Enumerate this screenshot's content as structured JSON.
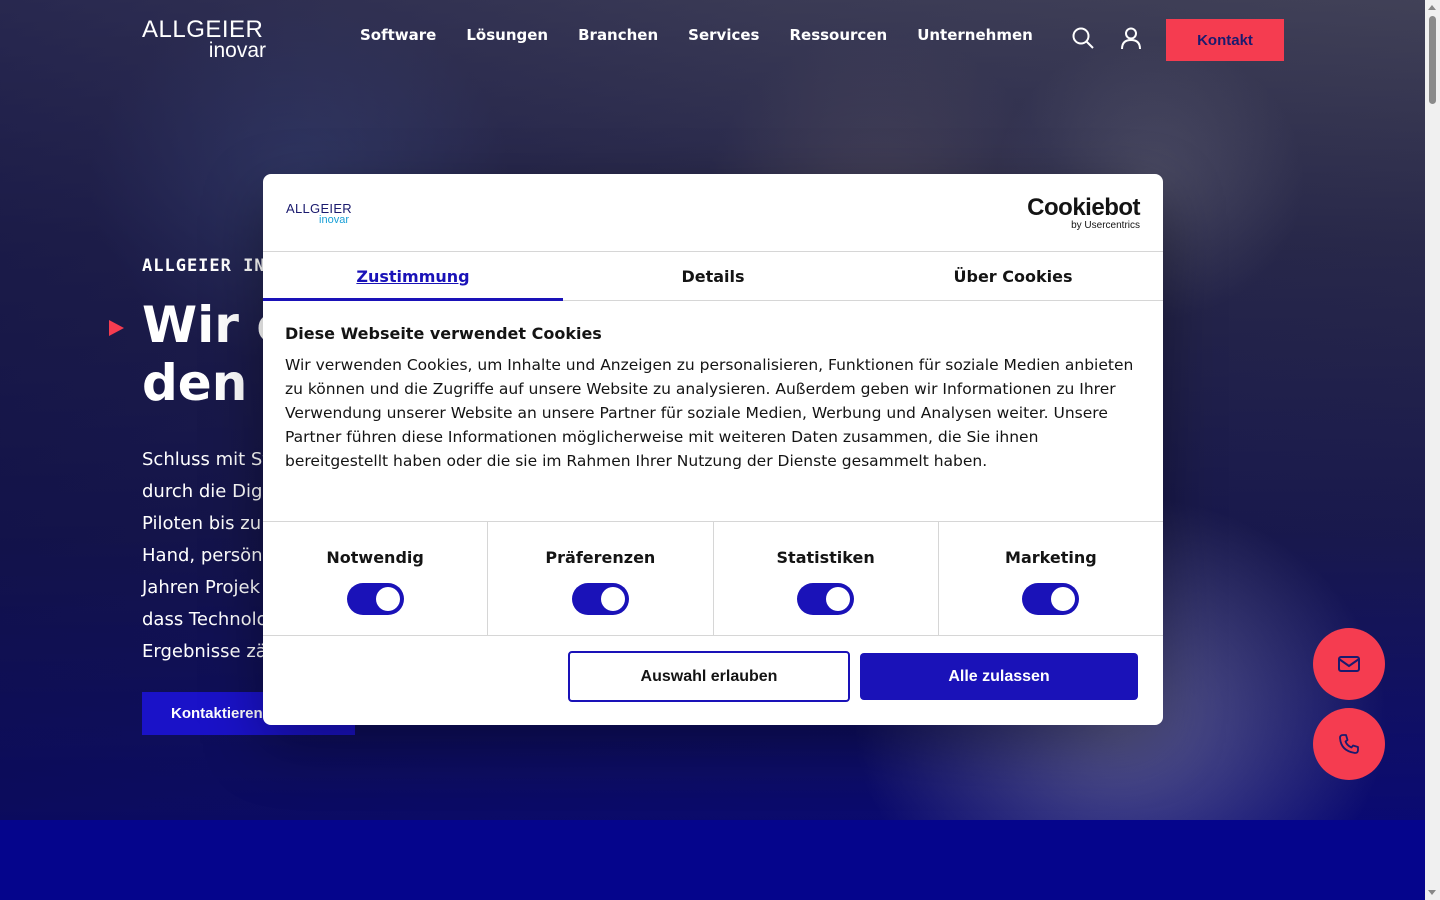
{
  "header": {
    "logo_top": "ALLGEIER",
    "logo_bottom": "inovar",
    "nav": [
      "Software",
      "Lösungen",
      "Branchen",
      "Services",
      "Ressourcen",
      "Unternehmen"
    ],
    "search_icon": "search-icon",
    "user_icon": "user-icon",
    "contact_label": "Kontakt"
  },
  "hero": {
    "eyebrow": "ALLGEIER IN",
    "headline_line1": "Wir c",
    "headline_line2": "den I",
    "intro_lines": [
      "Schluss mit St",
      "durch die Digi",
      "Piloten bis zu",
      "Hand, persönl",
      "Jahren Projek",
      "dass Technolo",
      "Ergebnisse zä"
    ],
    "cta_label": "Kontaktieren"
  },
  "floating": {
    "mail_icon": "mail-icon",
    "phone_icon": "phone-icon"
  },
  "cookie_dialog": {
    "logo_top": "ALLGEIER",
    "logo_bottom": "inovar",
    "provider_name": "Cookiebot",
    "provider_by": "by Usercentrics",
    "tabs": [
      {
        "label": "Zustimmung",
        "active": true
      },
      {
        "label": "Details",
        "active": false
      },
      {
        "label": "Über Cookies",
        "active": false
      }
    ],
    "title": "Diese Webseite verwendet Cookies",
    "text": "Wir verwenden Cookies, um Inhalte und Anzeigen zu personalisieren, Funktionen für soziale Medien anbieten zu können und die Zugriffe auf unsere Website zu analysieren. Außerdem geben wir Informationen zu Ihrer Verwendung unserer Website an unsere Partner für soziale Medien, Werbung und Analysen weiter. Unsere Partner führen diese Informationen möglicherweise mit weiteren Daten zusammen, die Sie ihnen bereitgestellt haben oder die sie im Rahmen Ihrer Nutzung der Dienste gesammelt haben.",
    "categories": [
      {
        "label": "Notwendig",
        "enabled": true
      },
      {
        "label": "Präferenzen",
        "enabled": true
      },
      {
        "label": "Statistiken",
        "enabled": true
      },
      {
        "label": "Marketing",
        "enabled": true
      }
    ],
    "allow_selection_label": "Auswahl erlauben",
    "allow_all_label": "Alle zulassen"
  },
  "colors": {
    "accent_red": "#f53c50",
    "brand_blue": "#1a12b8",
    "navy": "#0a0a7a"
  }
}
